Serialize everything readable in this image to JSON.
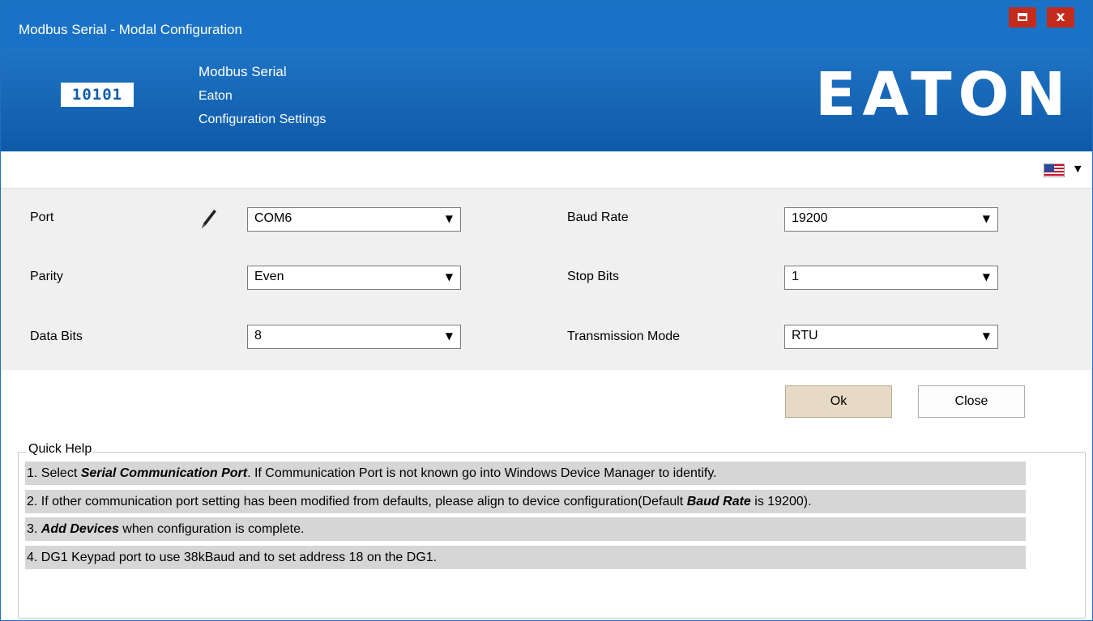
{
  "window": {
    "title": "Modbus Serial - Modal Configuration",
    "restore_icon": "restore-icon",
    "close_icon": "close-icon",
    "close_glyph": "x"
  },
  "banner": {
    "logo_text": "10101",
    "line1": "Modbus Serial",
    "line2": "Eaton",
    "line3": "Configuration Settings",
    "brand": "EATON"
  },
  "language": {
    "icon": "us-flag-icon"
  },
  "settings": {
    "port": {
      "label": "Port",
      "value": "COM6",
      "edit_icon": "pencil-icon"
    },
    "parity": {
      "label": "Parity",
      "value": "Even"
    },
    "data_bits": {
      "label": "Data Bits",
      "value": "8"
    },
    "baud_rate": {
      "label": "Baud Rate",
      "value": "19200"
    },
    "stop_bits": {
      "label": "Stop Bits",
      "value": "1"
    },
    "transmission_mode": {
      "label": "Transmission Mode",
      "value": "RTU"
    }
  },
  "actions": {
    "ok": "Ok",
    "close": "Close"
  },
  "help": {
    "legend": "Quick Help",
    "item1": {
      "pre": "1. Select ",
      "em": "Serial Communication Port",
      "post": ". If Communication Port is not known go into Windows Device Manager to identify."
    },
    "item2": {
      "pre": "2. If other communication port setting has been modified from defaults, please align to device configuration(Default ",
      "em": "Baud Rate",
      "post": " is 19200)."
    },
    "item3": {
      "pre": "3. ",
      "em": "Add Devices",
      "post": " when configuration is complete."
    },
    "item4": {
      "text": "4. DG1 Keypad port to use 38kBaud and to set address 18 on the DG1."
    }
  },
  "colors": {
    "titlebar": "#1a72c6",
    "banner": "#0e5aa8",
    "window_button": "#c42b1c",
    "ok_button": "#e6d9c5"
  }
}
